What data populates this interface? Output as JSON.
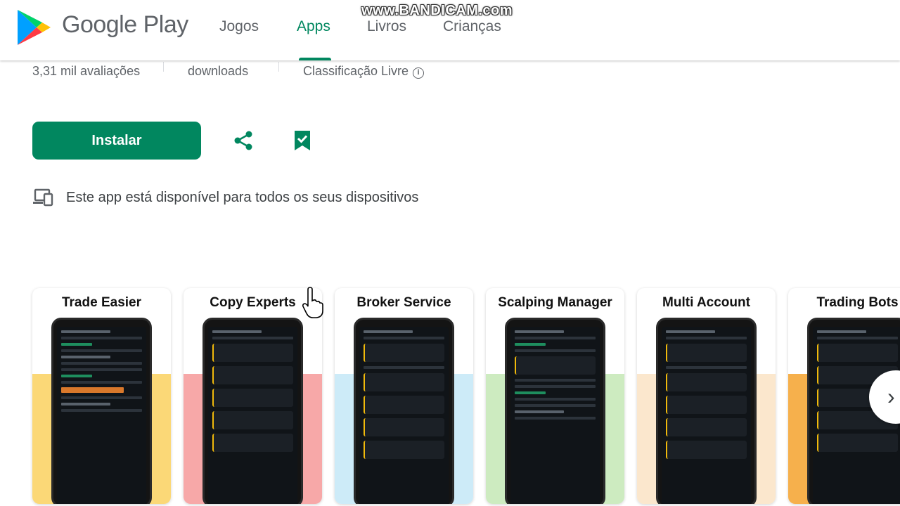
{
  "header": {
    "brand": "Google Play",
    "nav": [
      {
        "label": "Jogos",
        "active": false
      },
      {
        "label": "Apps",
        "active": true
      },
      {
        "label": "Livros",
        "active": false
      },
      {
        "label": "Crianças",
        "active": false
      }
    ],
    "watermark": "www.BANDICAM.com"
  },
  "stats": {
    "reviews": "3,31 mil avaliações",
    "downloads": "downloads",
    "rating": "Classificação Livre",
    "rating_icon": "info-icon"
  },
  "actions": {
    "install_label": "Instalar",
    "share_icon": "share-icon",
    "wishlist_icon": "bookmark-check-icon"
  },
  "devices": {
    "icon": "devices-icon",
    "text": "Este app está disponível para todos os seus dispositivos"
  },
  "screenshots": [
    {
      "title": "Trade Easier",
      "band_color": "#fbd877"
    },
    {
      "title": "Copy Experts",
      "band_color": "#f7a8a8"
    },
    {
      "title": "Broker Service",
      "band_color": "#cdebf8"
    },
    {
      "title": "Scalping Manager",
      "band_color": "#cdebc0"
    },
    {
      "title": "Multi Account",
      "band_color": "#fbe7cd"
    },
    {
      "title": "Trading Bots",
      "band_color": "#f6b04c"
    }
  ],
  "colors": {
    "accent": "#01875f",
    "text_secondary": "#5f6368"
  },
  "carousel_next_icon": "chevron-right-icon"
}
